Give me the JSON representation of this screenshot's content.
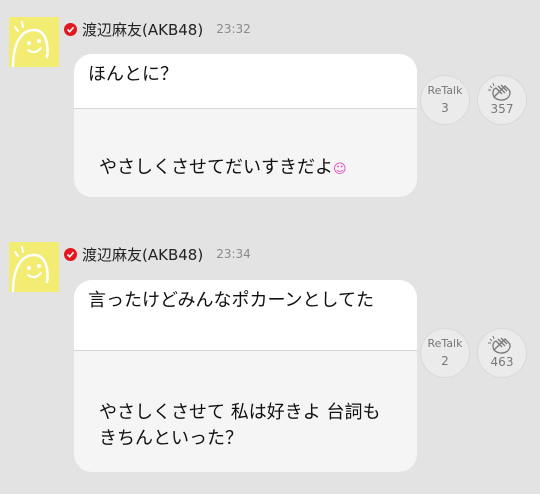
{
  "posts": [
    {
      "author": "渡辺麻友(AKB48)",
      "time": "23:32",
      "quote": "ほんとに？",
      "reply": "やさしくさせてだいすきだよ",
      "retalk_label": "ReTalk",
      "retalk_count": "3",
      "clap_count": "357"
    },
    {
      "author": "渡辺麻友(AKB48)",
      "time": "23:34",
      "quote": "言ったけどみんなポカーンとしてた",
      "reply": "やさしくさせて 私は好きよ 台詞もきちんといった？",
      "retalk_label": "ReTalk",
      "retalk_count": "2",
      "clap_count": "463"
    }
  ],
  "colors": {
    "background": "#e3e3e3",
    "verified": "#e4161f",
    "avatar": "#f2ec72"
  }
}
